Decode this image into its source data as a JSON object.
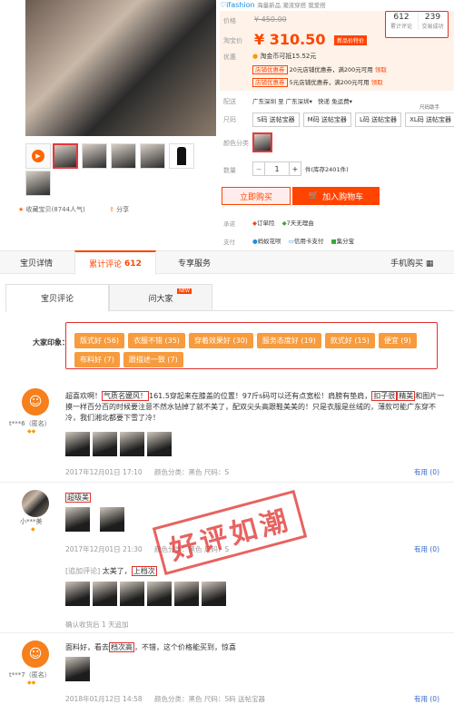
{
  "brand": "ifashion",
  "brand_sub": "海量新品 潮流穿搭 我爱搭",
  "price": {
    "label": "价格",
    "original": "¥ 450.00",
    "promo_label": "淘宝价",
    "promo": "¥ 310.50",
    "promo_badge": "新品价特价"
  },
  "stats": {
    "reviews_num": "612",
    "reviews_label": "累计评论",
    "sales_num": "239",
    "sales_label": "交易成功"
  },
  "benefits": {
    "label": "优惠",
    "coin": "淘金币可抵15.52元",
    "coupon1_tag": "店铺优惠券",
    "coupon1_text": "20元店铺优惠券，满200元可用",
    "coupon1_link": "领取",
    "coupon2_tag": "店铺优惠券",
    "coupon2_text": "5元店铺优惠券，满200元可用",
    "coupon2_link": "领取"
  },
  "delivery": {
    "label": "配送",
    "from": "广东深圳",
    "to_label": "至",
    "to": "广东深圳",
    "express": "快递 免运费"
  },
  "size": {
    "label": "尺码",
    "guide": "尺码助手",
    "options": [
      "S码 送帖宝器",
      "M码 送帖宝器",
      "L码 送帖宝器",
      "XL码 送帖宝器"
    ]
  },
  "color": {
    "label": "颜色分类"
  },
  "qty": {
    "label": "数量",
    "value": "1",
    "minus": "−",
    "plus": "+",
    "unit": "件(库存2401件)"
  },
  "buy_label": "立即购买",
  "cart_label": "加入购物车",
  "promise": {
    "label": "承诺",
    "item1": "订单险",
    "item2": "7天无理由"
  },
  "pay": {
    "label": "支付",
    "item1": "蚂蚁花呗",
    "item2": "信用卡支付",
    "item3": "集分宝"
  },
  "fav": {
    "label": "收藏宝贝",
    "count": "(8744人气)"
  },
  "share": "分享",
  "tabs": {
    "detail": "宝贝详情",
    "reviews": "累计评论",
    "reviews_count": "612",
    "service": "专享服务",
    "mobile": "手机购买"
  },
  "subtabs": {
    "reviews": "宝贝评论",
    "ask": "问大家",
    "ask_badge": "NEW"
  },
  "impressions": {
    "label": "大家印象：",
    "tags": [
      "版式好 (56)",
      "衣服不错 (35)",
      "穿着效果好 (30)",
      "服务态度好 (19)",
      "款式好 (15)",
      "便宜 (9)",
      "布料好 (7)",
      "跟描述一致 (7)"
    ]
  },
  "reviews": [
    {
      "user": "t***6（匿名）",
      "text_before": "超喜欢啊！",
      "hl1": "气质名媛风！",
      "text_mid": "161.5穿起来在膝盖的位置！97斤s码可以还有点宽松！肩膀有垫肩，",
      "hl2a": "扣子很",
      "hl2b": "精美",
      "text_after": "和图片一摸一样百分百的时候要注意不然水钻掉了就不美了，配双尖头高跟鞋美美的！只是衣服是丝绒的，薄款可能广东穿不冷，我们湘北都要下雪了冷！",
      "date": "2017年12月01日 17:10",
      "variant": "颜色分类：黑色  尺码：S",
      "useful": "有用 (0)"
    },
    {
      "user": "小***美",
      "text_before": "",
      "hl1": "超级美",
      "date": "2017年12月01日 21:30",
      "variant": "颜色分类：黑色  尺码：S",
      "useful": "有用 (0)",
      "followup_tag": "[追加评论]",
      "followup_text": "太美了，",
      "followup_hl": "上档次",
      "followup_meta": "确认收货后 1 天追加"
    },
    {
      "user": "t***7（匿名）",
      "text_before": "面料好，看去",
      "hl1": "档次高",
      "text_after": "，不错，这个价格能买到，惊喜",
      "date": "2018年01月12日 14:58",
      "variant": "颜色分类：黑色  尺码：S码 送帖宝器",
      "useful": "有用 (0)"
    }
  ],
  "stamp": "好评如潮"
}
